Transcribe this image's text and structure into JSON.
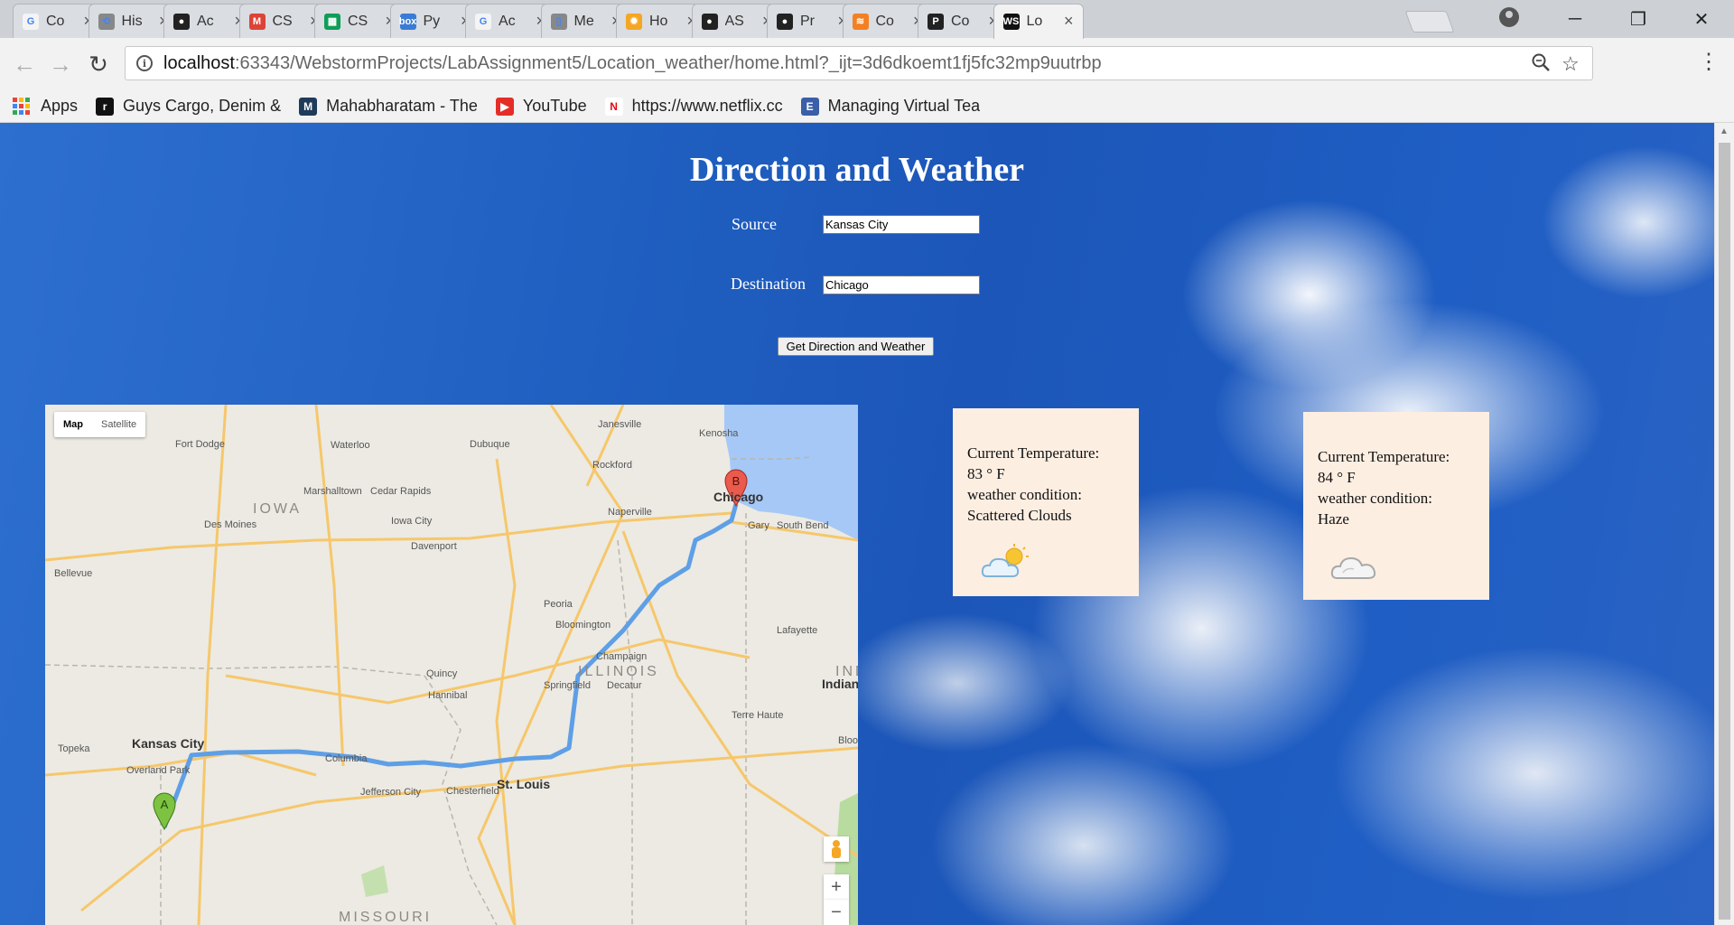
{
  "browser": {
    "tabs": [
      {
        "title": "Co",
        "icon_color": "#f4f4f4",
        "icon_text": "G"
      },
      {
        "title": "His",
        "icon_color": "#888888",
        "icon_text": "⟲"
      },
      {
        "title": "Ac",
        "icon_color": "#222222",
        "icon_text": "●"
      },
      {
        "title": "CS",
        "icon_color": "#db4437",
        "icon_text": "M"
      },
      {
        "title": "CS",
        "icon_color": "#0f9d58",
        "icon_text": "▦"
      },
      {
        "title": "Py",
        "icon_color": "#3a7bd5",
        "icon_text": "box"
      },
      {
        "title": "Ac",
        "icon_color": "#f4f4f4",
        "icon_text": "G"
      },
      {
        "title": "Me",
        "icon_color": "#888888",
        "icon_text": "▯"
      },
      {
        "title": "Ho",
        "icon_color": "#f5a623",
        "icon_text": "✹"
      },
      {
        "title": "AS",
        "icon_color": "#222222",
        "icon_text": "●"
      },
      {
        "title": "Pr",
        "icon_color": "#222222",
        "icon_text": "●"
      },
      {
        "title": "Co",
        "icon_color": "#f48024",
        "icon_text": "≋"
      },
      {
        "title": "Co",
        "icon_color": "#222222",
        "icon_text": "P"
      },
      {
        "title": "Lo",
        "icon_color": "#111111",
        "icon_text": "WS",
        "active": true
      }
    ],
    "url_host": "localhost",
    "url_rest": ":63343/WebstormProjects/LabAssignment5/Location_weather/home.html?_ijt=3d6dkoemt1fj5fc32mp9uutrbp",
    "bookmarks": [
      {
        "label": "Apps",
        "icon": "apps-grid"
      },
      {
        "label": "Guys Cargo, Denim &",
        "icon_color": "#111111",
        "icon_text": "r"
      },
      {
        "label": "Mahabharatam - The",
        "icon_color": "#1f3b5a",
        "icon_text": "M"
      },
      {
        "label": "YouTube",
        "icon_color": "#e52d27",
        "icon_text": "▶"
      },
      {
        "label": "https://www.netflix.cc",
        "icon_color": "#ffffff",
        "icon_text": "N"
      },
      {
        "label": "Managing Virtual Tea",
        "icon_color": "#3b5ea8",
        "icon_text": "E"
      }
    ]
  },
  "page": {
    "title": "Direction and Weather",
    "source_label": "Source",
    "source_value": "Kansas City",
    "destination_label": "Destination",
    "destination_value": "Chicago",
    "button_label": "Get Direction and Weather"
  },
  "map": {
    "type_map": "Map",
    "type_satellite": "Satellite",
    "zoom_in": "+",
    "zoom_out": "−",
    "marker_a": "A",
    "marker_b": "B",
    "states": [
      "IOWA",
      "ILLINOIS",
      "MISSOURI",
      "INDI"
    ],
    "cities": [
      "Janesville",
      "Kenosha",
      "Fort Dodge",
      "Waterloo",
      "Dubuque",
      "Rockford",
      "Marshalltown",
      "Cedar Rapids",
      "Chicago",
      "Naperville",
      "Des Moines",
      "Iowa City",
      "Gary",
      "South Bend",
      "Davenport",
      "Bellevue",
      "Peoria",
      "Bloomington",
      "Lafayette",
      "Champaign",
      "Quincy",
      "Hannibal",
      "Springfield",
      "Decatur",
      "Indian",
      "Topeka",
      "Kansas City",
      "Overland Park",
      "Columbia",
      "Terre Haute",
      "Bloomington",
      "Jefferson City",
      "Chesterfield",
      "St. Louis"
    ]
  },
  "weather_source": {
    "temp_label": "Current Temperature:",
    "temp_value": "83 ° F",
    "condition_label": "weather condition:",
    "condition_value": "Scattered Clouds",
    "icon": "partly-cloudy-icon"
  },
  "weather_destination": {
    "temp_label": "Current Temperature:",
    "temp_value": "84 ° F",
    "condition_label": "weather condition:",
    "condition_value": "Haze",
    "icon": "cloud-icon"
  }
}
